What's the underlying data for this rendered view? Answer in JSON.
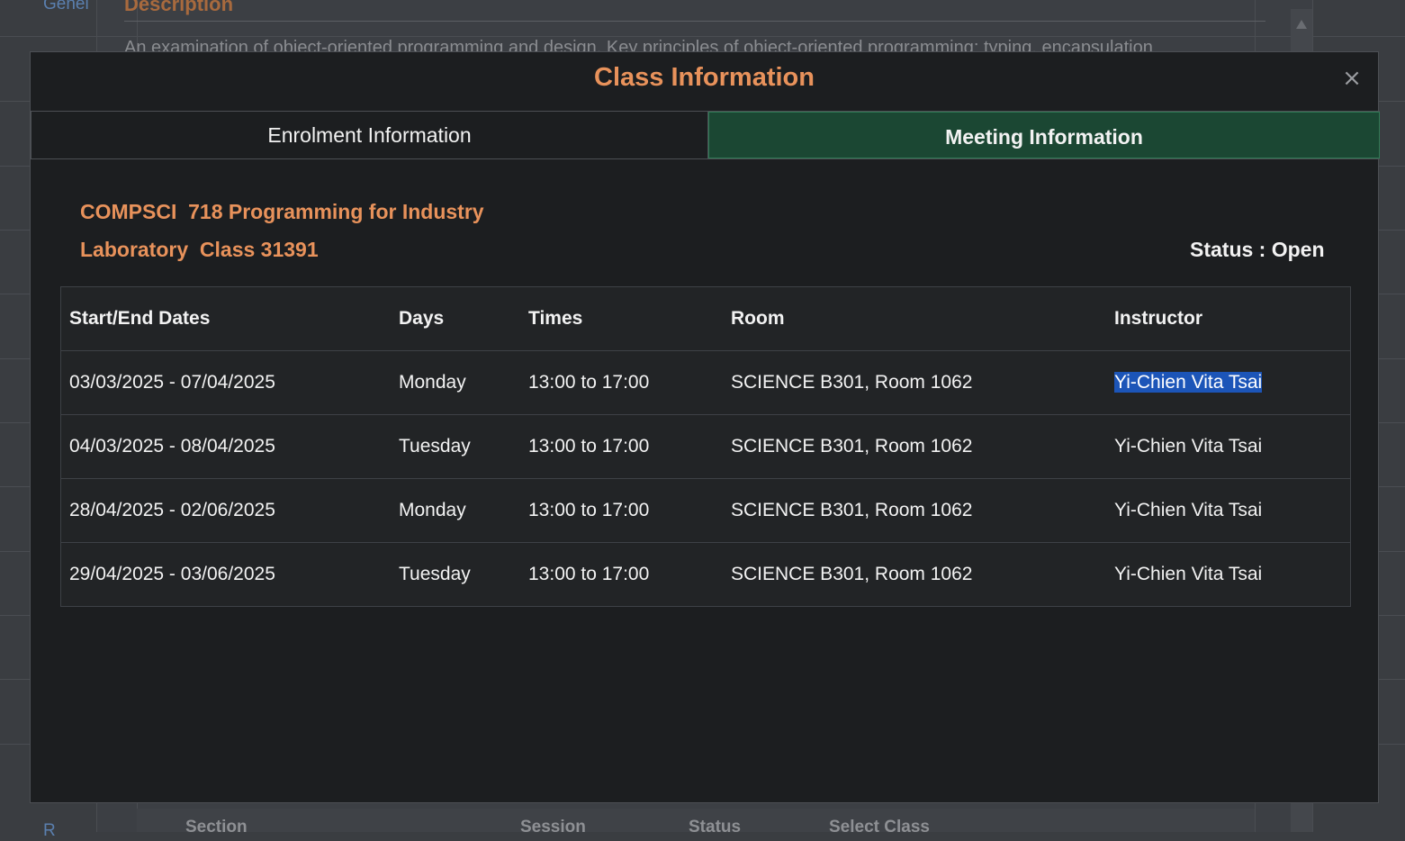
{
  "background": {
    "side_link_top": "Genel",
    "side_link_bottom": "R",
    "section_heading": "Description",
    "description": "An examination of object-oriented programming and design. Key principles of object-oriented programming: typing, encapsulation",
    "footer_headers": [
      "Section",
      "Session",
      "Status",
      "Select Class"
    ]
  },
  "modal": {
    "title": "Class Information",
    "close_label": "×",
    "tabs": [
      {
        "label": "Enrolment Information",
        "active": false
      },
      {
        "label": "Meeting Information",
        "active": true
      }
    ],
    "course_title": "COMPSCI  718 Programming for Industry",
    "class_line": "Laboratory  Class 31391",
    "status_text": "Status : Open",
    "table": {
      "headers": [
        "Start/End Dates",
        "Days",
        "Times",
        "Room",
        "Instructor"
      ],
      "rows": [
        [
          "03/03/2025 - 07/04/2025",
          "Monday",
          "13:00 to 17:00",
          "SCIENCE B301, Room 1062",
          "Yi-Chien Vita Tsai"
        ],
        [
          "04/03/2025 - 08/04/2025",
          "Tuesday",
          "13:00 to 17:00",
          "SCIENCE B301, Room 1062",
          "Yi-Chien Vita Tsai"
        ],
        [
          "28/04/2025 - 02/06/2025",
          "Monday",
          "13:00 to 17:00",
          "SCIENCE B301, Room 1062",
          "Yi-Chien Vita Tsai"
        ],
        [
          "29/04/2025 - 03/06/2025",
          "Tuesday",
          "13:00 to 17:00",
          "SCIENCE B301, Room 1062",
          "Yi-Chien Vita Tsai"
        ]
      ]
    }
  },
  "colors": {
    "accent_orange": "#e8925b",
    "active_tab_green": "#1b4733",
    "selection_blue": "#1c55b8"
  }
}
